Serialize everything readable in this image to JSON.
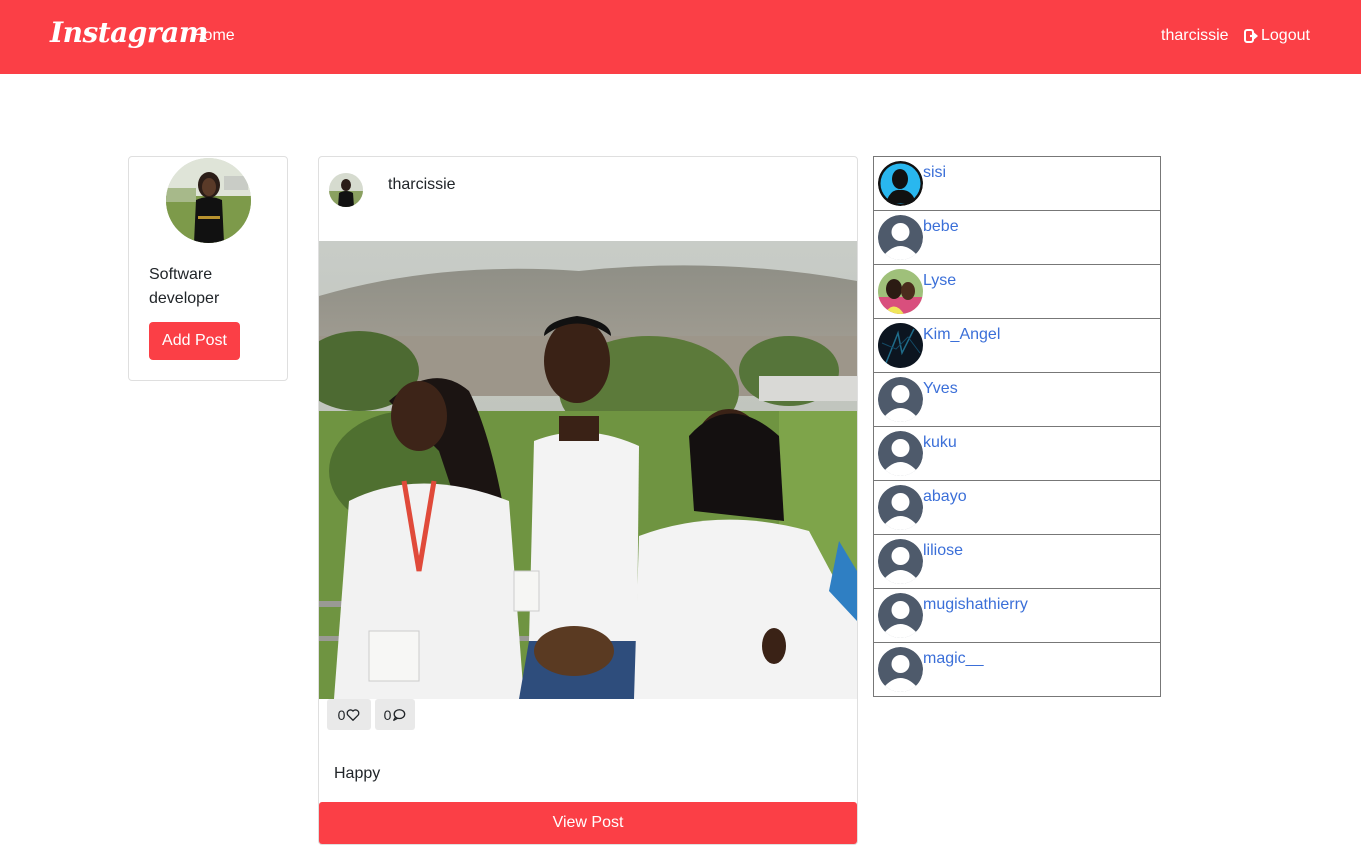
{
  "navbar": {
    "brand": "Instagram",
    "home": "Home",
    "username": "tharcissie",
    "logout": "Logout"
  },
  "profile": {
    "bio": "Software developer",
    "add_post": "Add Post"
  },
  "post": {
    "username": "tharcissie",
    "likes": "0",
    "comments": "0",
    "caption": "Happy",
    "view_post": "View Post"
  },
  "users": [
    {
      "name": "sisi",
      "avatar": "silhouette-blue"
    },
    {
      "name": "bebe",
      "avatar": "default"
    },
    {
      "name": "Lyse",
      "avatar": "photo"
    },
    {
      "name": "Kim_Angel",
      "avatar": "dark-photo"
    },
    {
      "name": "Yves",
      "avatar": "default"
    },
    {
      "name": "kuku",
      "avatar": "default"
    },
    {
      "name": "abayo",
      "avatar": "default"
    },
    {
      "name": "liliose",
      "avatar": "default"
    },
    {
      "name": "mugishathierry",
      "avatar": "default"
    },
    {
      "name": "magic__",
      "avatar": "default"
    }
  ],
  "colors": {
    "accent": "#fb3f46",
    "link": "#3b6fd8"
  }
}
